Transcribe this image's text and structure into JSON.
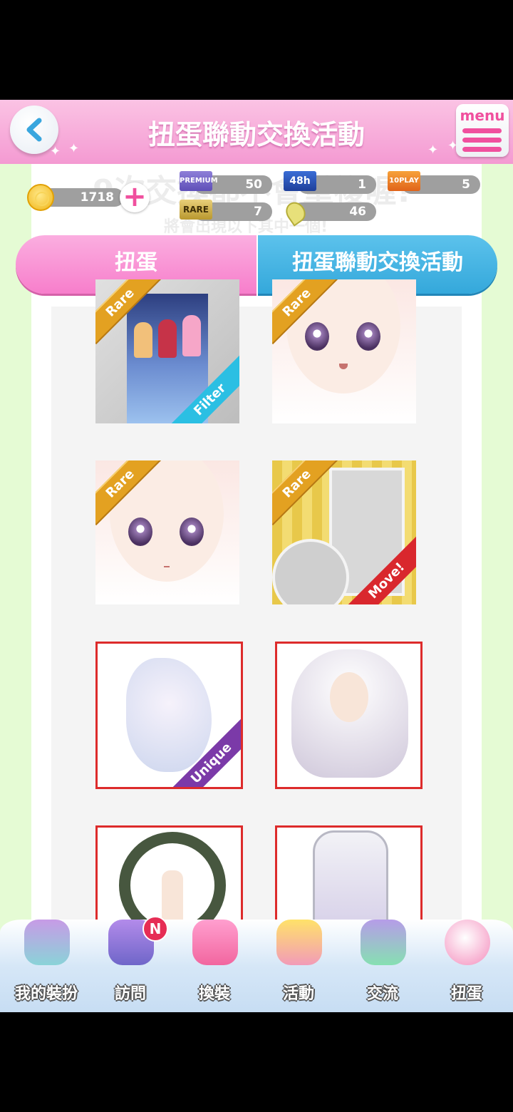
{
  "header": {
    "title": "扭蛋聯動交換活動",
    "menu_label": "menu"
  },
  "background_text": {
    "line1": "9次交換都不會重複喔!",
    "line2": "將會出現以下其中一個!"
  },
  "currency": {
    "coins": "1718",
    "premium_tickets": "50",
    "ticket_48h": "1",
    "ticket_10play": "5",
    "rare_tickets": "7",
    "leaves": "46",
    "ticket_labels": {
      "premium": "PREMIUM",
      "h48": "48h",
      "play10": "10PLAY",
      "rare": "RARE"
    }
  },
  "tabs": {
    "left": "扭蛋",
    "right": "扭蛋聯動交換活動",
    "active": "right"
  },
  "items": [
    {
      "badge": "Rare",
      "corner": "Filter"
    },
    {
      "badge": "Rare"
    },
    {
      "badge": "Rare"
    },
    {
      "badge": "Rare",
      "corner": "Move!"
    },
    {
      "corner": "Unique"
    },
    {},
    {},
    {}
  ],
  "nav": [
    {
      "label": "我的裝扮",
      "icon": "my-outfit-icon"
    },
    {
      "label": "訪問",
      "icon": "visit-icon",
      "badge": "N"
    },
    {
      "label": "換裝",
      "icon": "dress-up-icon"
    },
    {
      "label": "活動",
      "icon": "event-icon"
    },
    {
      "label": "交流",
      "icon": "community-icon"
    },
    {
      "label": "扭蛋",
      "icon": "gacha-icon"
    }
  ],
  "colors": {
    "header_pink": "#f49ad2",
    "tab_pink": "#f77ecb",
    "tab_blue": "#34a8db",
    "selection_red": "#dd2b2b"
  }
}
